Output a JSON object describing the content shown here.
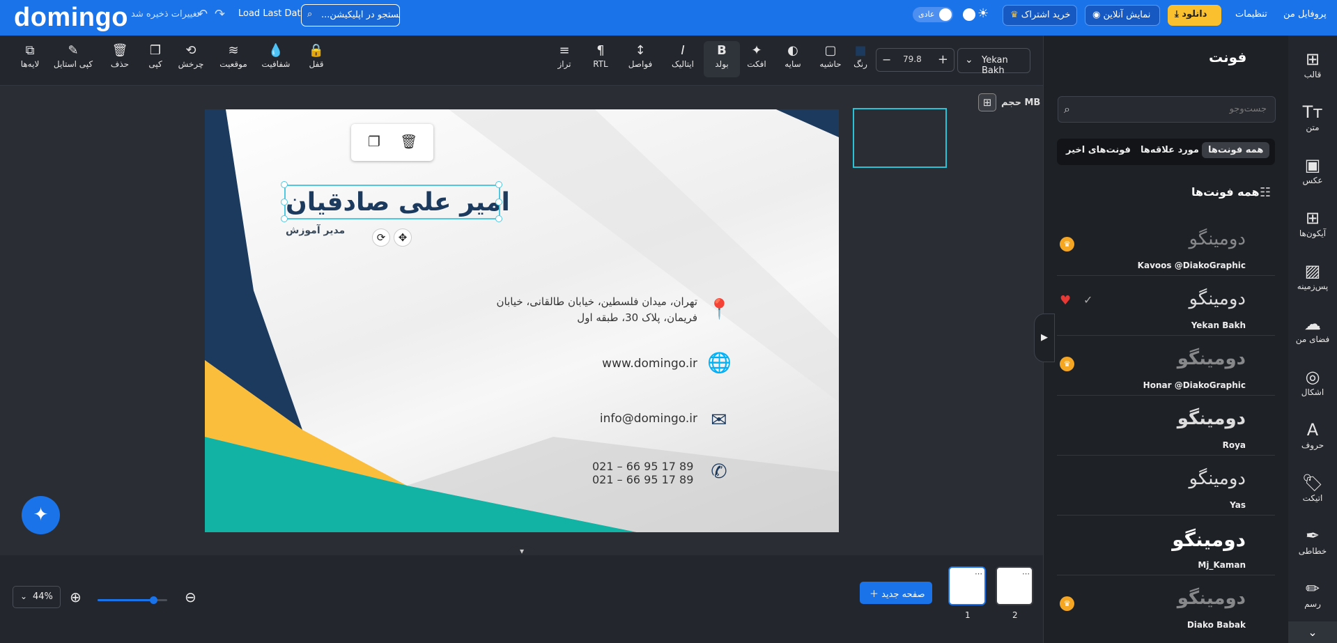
{
  "header": {
    "logo": "domingo",
    "saved_status": "تغییرات ذخیره شد",
    "load_last_data": "Load Last Data",
    "search_placeholder": "...جستجو در اپلیکیشن",
    "theme_mode": "عادی",
    "subscribe": "خرید اشتراک",
    "online_show": "نمایش آنلاین",
    "download": "دانلود",
    "settings": "تنظیمات",
    "profile": "پروفایل من"
  },
  "toolbar": {
    "layers": "لایه‌ها",
    "copy_style": "کپی استایل",
    "delete": "حذف",
    "copy": "کپی",
    "rotate": "چرخش",
    "position": "موقعیت",
    "opacity": "شفافیت",
    "lock": "قفل",
    "align": "تراز",
    "rtl": "RTL",
    "spacing": "فواصل",
    "italic": "ایتالیک",
    "bold": "بولد",
    "effect": "افکت",
    "shadow": "سایه",
    "border": "حاشیه",
    "color": "رنگ",
    "font_size": "79.8",
    "font_name": "Yekan Bakh",
    "text_color": "#1c3a5e"
  },
  "canvas": {
    "name": "امیر علی صادقیان",
    "role": "مدیر آموزش",
    "address_line1": "تهران، میدان فلسطین، خیابان طالقانی، خیابان",
    "address_line2": "فریمان، پلاک 30، طبقه اول",
    "website": "www.domingo.ir",
    "email": "info@domingo.ir",
    "phone1": "021 – 66 95 17 89",
    "phone2": "021 – 66 95 17 89",
    "size_label": "حجم MB",
    "colors": {
      "navy": "#1c3a5e",
      "yellow": "#fbbd3c",
      "teal": "#12b3a5"
    }
  },
  "bottom": {
    "zoom": "44%",
    "zoom_level": 0.8,
    "new_page": "صفحه جدید",
    "page_numbers": [
      "1",
      "2"
    ]
  },
  "panel": {
    "title": "فونت",
    "search_placeholder": "جست‌وجو",
    "tabs": [
      "همه فونت‌ها",
      "مورد علاقه‌ها",
      "فونت‌های اخیر"
    ],
    "section_title": "همه فونت‌ها",
    "fonts": [
      {
        "preview": "دومینگو",
        "name": "Kavoos @DiakoGraphic",
        "premium": true
      },
      {
        "preview": "دومینگو",
        "name": "Yekan Bakh",
        "premium": false,
        "favorite": true
      },
      {
        "preview": "دومینگو",
        "name": "Honar @DiakoGraphic",
        "premium": true
      },
      {
        "preview": "دومینگو",
        "name": "Roya",
        "premium": false
      },
      {
        "preview": "دومینگو",
        "name": "Yas",
        "premium": false
      },
      {
        "preview": "دومینگو",
        "name": "Mj_Kaman",
        "premium": false
      },
      {
        "preview": "دومینگو",
        "name": "Diako Babak",
        "premium": true
      }
    ]
  },
  "rail": [
    "قالب",
    "متن",
    "عکس",
    "آیکون‌ها",
    "پس‌زمینه",
    "فضای من",
    "اشکال",
    "حروف",
    "اتیکت",
    "خطاطی",
    "رسم"
  ]
}
